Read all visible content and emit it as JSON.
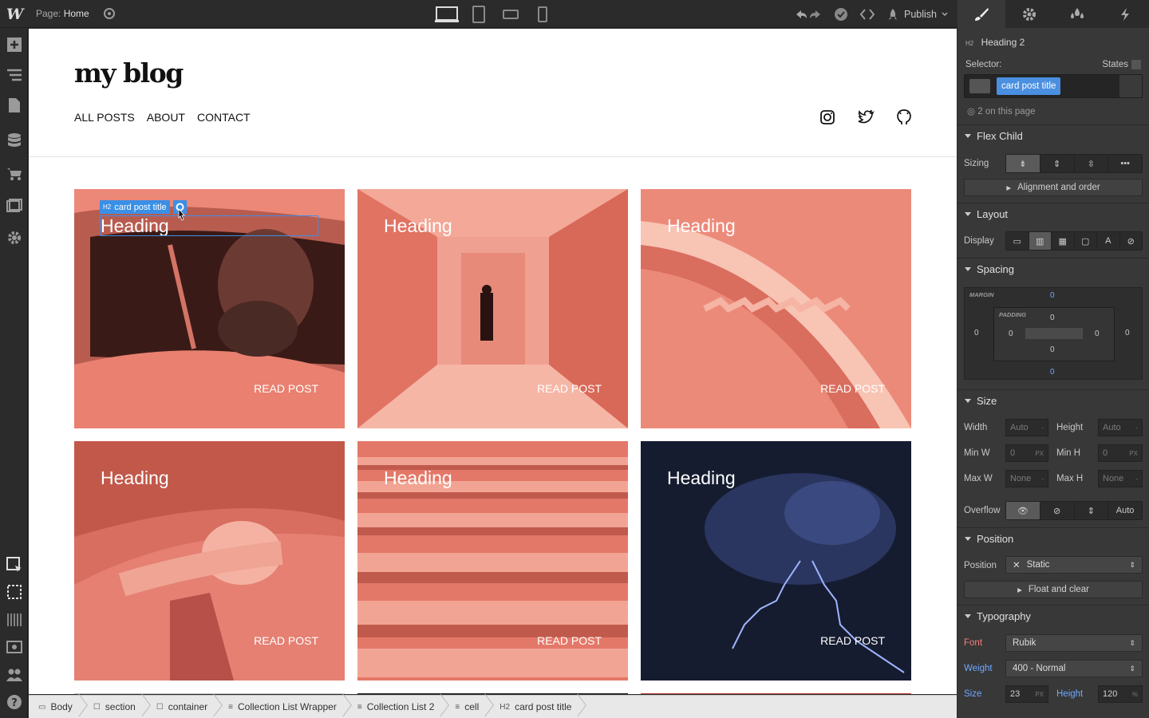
{
  "topbar": {
    "logo": "W",
    "page_prefix": "Page:",
    "page_name": "Home",
    "publish_label": "Publish"
  },
  "canvas": {
    "site_logo": "my blog",
    "nav": [
      "ALL POSTS",
      "ABOUT",
      "CONTACT"
    ],
    "cards": [
      {
        "heading": "Heading",
        "read": "READ POST"
      },
      {
        "heading": "Heading",
        "read": "READ POST"
      },
      {
        "heading": "Heading",
        "read": "READ POST"
      },
      {
        "heading": "Heading",
        "read": "READ POST"
      },
      {
        "heading": "Heading",
        "read": "READ POST"
      },
      {
        "heading": "Heading",
        "read": "READ POST"
      }
    ],
    "selection_tag": "card post title",
    "selection_tag_prefix": "H2"
  },
  "breadcrumbs": [
    "Body",
    "section",
    "container",
    "Collection List Wrapper",
    "Collection List 2",
    "cell",
    "card post title"
  ],
  "breadcrumb_icons": [
    "▭",
    "☐",
    "☐",
    "≡",
    "≡",
    "≡",
    "H2"
  ],
  "panel": {
    "element_type": "H2",
    "element_name": "Heading 2",
    "selector_label": "Selector:",
    "states_label": "States",
    "selector_class": "card post title",
    "on_page": "2 on this page",
    "flex_child": {
      "title": "Flex Child",
      "sizing_label": "Sizing",
      "alignment_btn": "Alignment and order"
    },
    "layout": {
      "title": "Layout",
      "display_label": "Display"
    },
    "spacing": {
      "title": "Spacing",
      "margin_label": "MARGIN",
      "padding_label": "PADDING",
      "margin": {
        "top": "0",
        "right": "0",
        "bottom": "0",
        "left": "0"
      },
      "padding": {
        "top": "0",
        "right": "0",
        "bottom": "0",
        "left": "0"
      }
    },
    "size": {
      "title": "Size",
      "width_label": "Width",
      "width": "Auto",
      "height_label": "Height",
      "height": "Auto",
      "minw_label": "Min W",
      "minw": "0",
      "minw_unit": "PX",
      "minh_label": "Min H",
      "minh": "0",
      "minh_unit": "PX",
      "maxw_label": "Max W",
      "maxw": "None",
      "maxh_label": "Max H",
      "maxh": "None",
      "dash": "-",
      "overflow_label": "Overflow",
      "overflow_auto": "Auto"
    },
    "position": {
      "title": "Position",
      "label": "Position",
      "value": "Static",
      "float_btn": "Float and clear"
    },
    "typography": {
      "title": "Typography",
      "font_label": "Font",
      "font": "Rubik",
      "weight_label": "Weight",
      "weight": "400 - Normal",
      "size_label": "Size",
      "size": "23",
      "size_unit": "PX",
      "height_label": "Height",
      "height": "120",
      "height_unit": "%"
    }
  },
  "colors": {
    "accent": "#3a8fe6",
    "panel_bg": "#383838",
    "card_tint": "#e97a6c"
  }
}
